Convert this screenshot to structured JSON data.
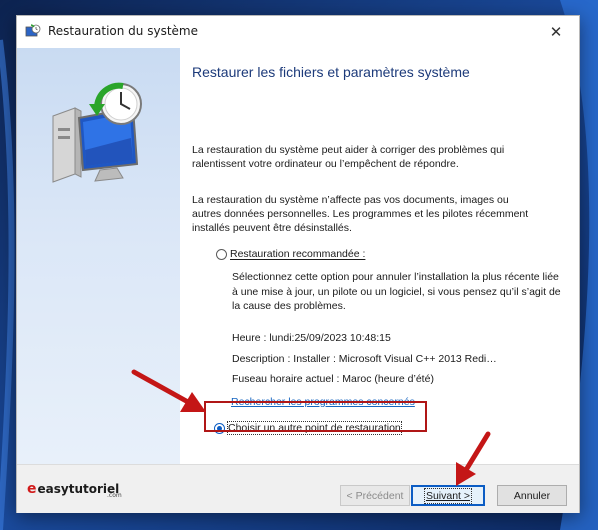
{
  "window": {
    "title": "Restauration du système",
    "close_glyph": "✕"
  },
  "main": {
    "heading": "Restaurer les fichiers et paramètres système",
    "intro": "La restauration du système peut aider à corriger des problèmes qui ralentissent votre ordinateur ou l’empêchent de répondre.",
    "intro2": "La restauration du système n’affecte pas vos documents, images ou autres données personnelles. Les programmes et les pilotes récemment installés peuvent être désinstallés.",
    "option_recommended": {
      "label": "Restauration recommandée :",
      "checked": false,
      "description": "Sélectionnez cette option pour annuler l’installation la plus récente liée à une mise à jour, un pilote ou un logiciel, si vous pensez qu’il s’agit de la cause des problèmes.",
      "time": "Heure : lundi:25/09/2023 10:48:15",
      "desc": "Description : Installer : Microsoft Visual C++ 2013 Redi…",
      "timezone": "Fuseau horaire actuel : Maroc (heure d’été)",
      "link": "Rechercher les programmes concernés"
    },
    "option_other": {
      "label": "Choisir un autre point de restauration",
      "checked": true
    }
  },
  "footer": {
    "brand": "easytutoriel",
    "brand_e": "e",
    "brand_sub": ".com",
    "prev_label": "< Précédent",
    "next_label": "Suivant >",
    "cancel_label": "Annuler"
  },
  "colors": {
    "accent": "#0b5cc4",
    "highlight": "#b01616",
    "heading": "#1c3a7a"
  }
}
